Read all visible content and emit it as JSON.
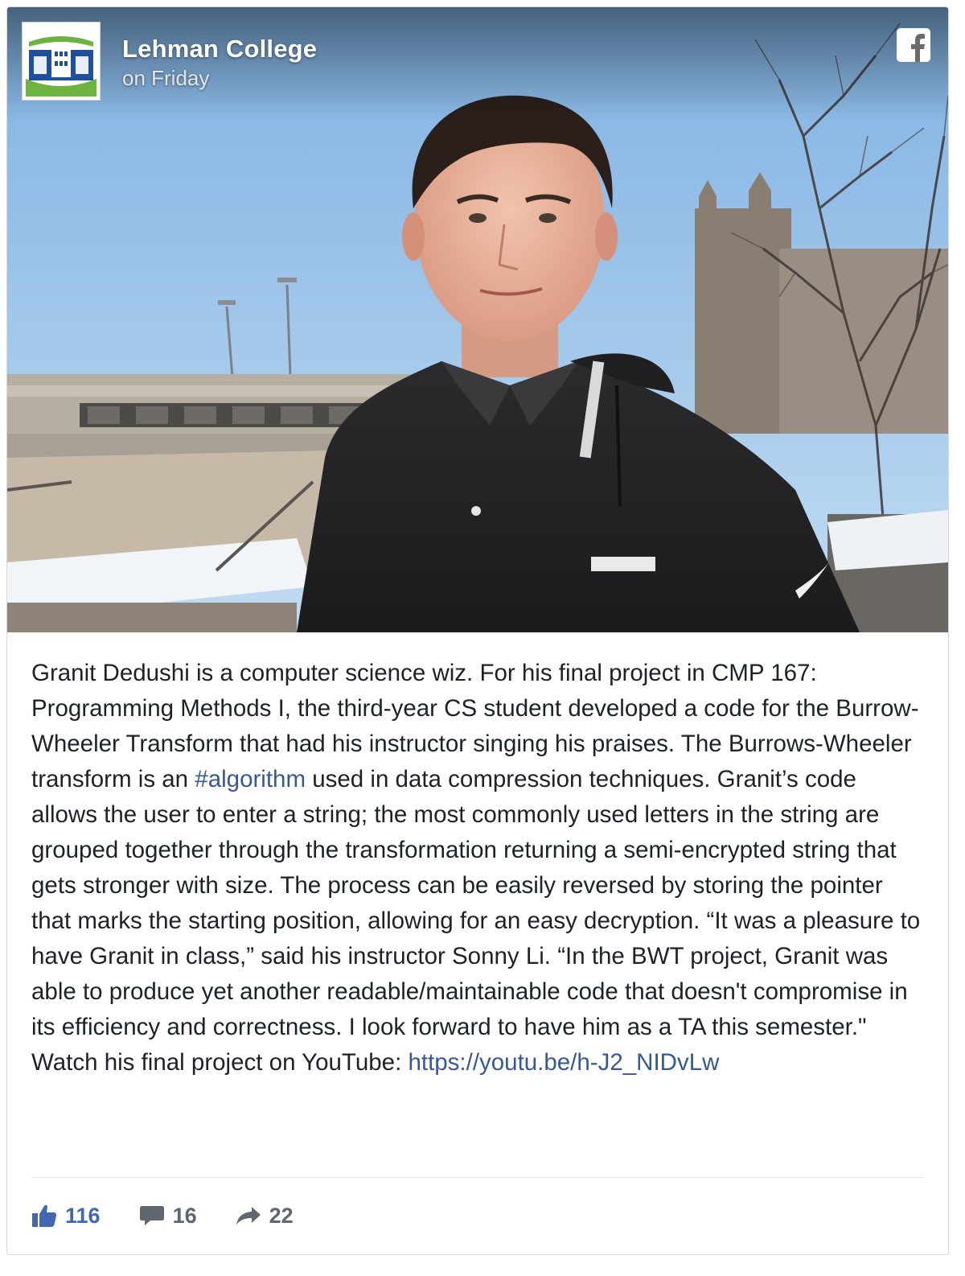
{
  "page": {
    "name": "Lehman College",
    "time": "on Friday"
  },
  "brand": {
    "facebook_blue": "#4267b2",
    "link_color": "#365899",
    "logo_green": "#6db33f",
    "logo_blue": "#1f4e9a"
  },
  "icons": [
    "lehman-college-logo",
    "facebook-icon",
    "like-thumb-icon",
    "comment-icon",
    "share-arrow-icon"
  ],
  "post": {
    "text_before_hashtag": "Granit Dedushi is a computer science wiz. For his final project in CMP 167: Programming Methods I, the third-year CS student developed a code for the Burrow-Wheeler Transform that had his instructor singing his praises. The Burrows-Wheeler transform is an ",
    "hashtag": "#algorithm",
    "text_after_hashtag": " used in data compression techniques. Granit’s code allows the user to enter a string; the most commonly used letters in the string are grouped together through the transformation returning a semi-encrypted string that gets stronger with size. The process can be easily reversed by storing the pointer that marks the starting position, allowing for an easy decryption. “It was a pleasure to have Granit in class,” said his instructor Sonny Li. “In the BWT project, Granit was able to produce yet another readable/maintainable code that doesn't compromise in its efficiency and correctness. I look forward to have him as a TA this semester.\" Watch his final project on YouTube: ",
    "link": "https://youtu.be/h-J2_NIDvLw"
  },
  "stats": {
    "likes": "116",
    "comments": "16",
    "shares": "22"
  }
}
